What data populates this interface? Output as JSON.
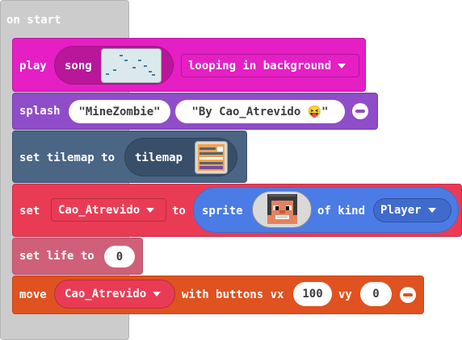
{
  "on_start": {
    "label": "on start"
  },
  "play_block": {
    "label": "play",
    "song_label": "song",
    "mode": "looping in background",
    "color": "#e51fc4"
  },
  "splash_block": {
    "label": "splash",
    "arg1": "MineZombie",
    "arg2": "By Cao_Atrevido 😝",
    "color": "#8f4dc9"
  },
  "tilemap_block": {
    "label": "set tilemap to",
    "tilemap_label": "tilemap",
    "color": "#4b6584"
  },
  "sprite_block": {
    "label": "set",
    "variable": "Cao_Atrevido",
    "to_label": "to",
    "sprite_label": "sprite",
    "of_kind_label": "of kind",
    "kind": "Player",
    "color": "#ea3b55",
    "sprite_color": "#4b7be5"
  },
  "life_block": {
    "label": "set life to",
    "value": "0",
    "color": "#d0607a"
  },
  "move_block": {
    "label": "move",
    "variable": "Cao_Atrevido",
    "with_label": "with buttons vx",
    "vx": "100",
    "vy_label": "vy",
    "vy": "0",
    "color": "#e0521f"
  }
}
